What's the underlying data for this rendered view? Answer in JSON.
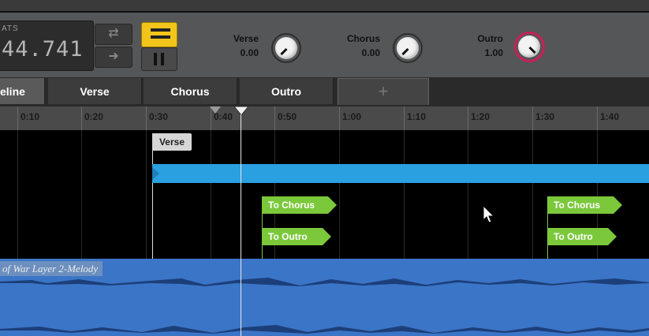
{
  "counter": {
    "label": "ATS",
    "value": "44.741"
  },
  "params": [
    {
      "name": "Verse",
      "value": "0.00"
    },
    {
      "name": "Chorus",
      "value": "0.00"
    },
    {
      "name": "Outro",
      "value": "1.00"
    }
  ],
  "tabs": [
    {
      "label": "eline",
      "active": true
    },
    {
      "label": "Verse",
      "active": false
    },
    {
      "label": "Chorus",
      "active": false
    },
    {
      "label": "Outro",
      "active": false
    }
  ],
  "add_tab_label": "+",
  "ruler": {
    "ticks": [
      "0:10",
      "0:20",
      "0:30",
      "0:40",
      "0:50",
      "1:00",
      "1:10",
      "1:20",
      "1:30",
      "1:40"
    ]
  },
  "verse_marker": "Verse",
  "transitions": [
    {
      "label": "To Chorus"
    },
    {
      "label": "To Outro"
    },
    {
      "label": "To Chorus"
    },
    {
      "label": "To Outro"
    }
  ],
  "track": {
    "label": "of War Layer 2-Melody"
  },
  "colors": {
    "accent_yellow": "#f3c51b",
    "region_blue": "#2aa0e0",
    "transition_green": "#7cc83b",
    "track_blue": "#3b75c7",
    "outro_knob_ring": "#c8205a"
  }
}
